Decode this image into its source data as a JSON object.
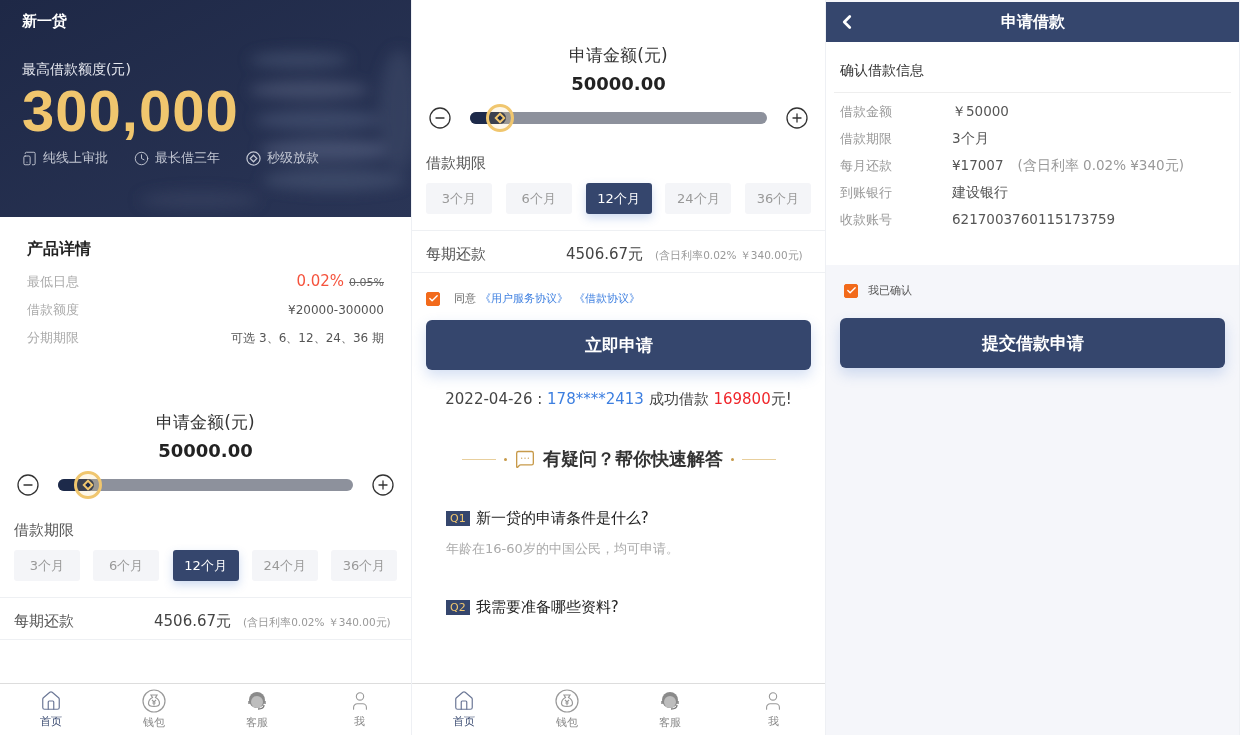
{
  "home_screen": {
    "brand": "新一贷",
    "hero": {
      "label": "最高借款额度(元)",
      "amount": "300,000",
      "features": [
        {
          "kind": "tablet",
          "text": "纯线上审批"
        },
        {
          "kind": "clock",
          "text": "最长借三年"
        },
        {
          "kind": "coin",
          "text": "秒级放款"
        }
      ]
    },
    "details": {
      "title": "产品详情",
      "rows": [
        {
          "label": "最低日息",
          "value": "0.02%",
          "old_value": "0.05%"
        },
        {
          "label": "借款额度",
          "value": "¥20000-300000"
        },
        {
          "label": "分期期限",
          "value": "可选 3、6、12、24、36 期"
        }
      ]
    },
    "amount": {
      "label": "申请金额(元)",
      "value": "50000.00",
      "level": 0.1
    },
    "term": {
      "label": "借款期限",
      "options": [
        {
          "label": "3个月",
          "selected": false
        },
        {
          "label": "6个月",
          "selected": false
        },
        {
          "label": "12个月",
          "selected": true
        },
        {
          "label": "24个月",
          "selected": false
        },
        {
          "label": "36个月",
          "selected": false
        }
      ]
    },
    "repayment": {
      "label": "每期还款",
      "amount": "4506.67元",
      "note": "(含日利率0.02% ￥340.00元)"
    },
    "tab_bar": [
      {
        "kind": "home",
        "label": "首页",
        "selected": true
      },
      {
        "kind": "wallet",
        "label": "钱包",
        "selected": false
      },
      {
        "kind": "service",
        "label": "客服",
        "selected": false
      },
      {
        "kind": "profile",
        "label": "我",
        "selected": false
      }
    ]
  },
  "apply_screen": {
    "amount": {
      "label": "申请金额(元)",
      "value": "50000.00",
      "level": 0.1
    },
    "term": {
      "label": "借款期限",
      "options": [
        {
          "label": "3个月",
          "selected": false
        },
        {
          "label": "6个月",
          "selected": false
        },
        {
          "label": "12个月",
          "selected": true
        },
        {
          "label": "24个月",
          "selected": false
        },
        {
          "label": "36个月",
          "selected": false
        }
      ]
    },
    "repayment": {
      "label": "每期还款",
      "amount": "4506.67元",
      "note": "(含日利率0.02% ￥340.00元)"
    },
    "agreement": {
      "checked": true,
      "text": "同意",
      "links": [
        "《用户服务协议》",
        "《借款协议》"
      ]
    },
    "apply_button": "立即申请",
    "ticker": {
      "date": "2022-04-26 :",
      "phone": "178****2413",
      "text": "成功借款",
      "amount": "169800",
      "suffix": "元!"
    },
    "faq": {
      "title": "有疑问？帮你快速解答",
      "items": [
        {
          "tag": "Q1",
          "question": "新一贷的申请条件是什么?",
          "answer": "年龄在16-60岁的中国公民，均可申请。"
        },
        {
          "tag": "Q2",
          "question": "我需要准备哪些资料?"
        }
      ]
    },
    "tab_bar": [
      {
        "kind": "home",
        "label": "首页",
        "selected": true
      },
      {
        "kind": "wallet",
        "label": "钱包",
        "selected": false
      },
      {
        "kind": "service",
        "label": "客服",
        "selected": false
      },
      {
        "kind": "profile",
        "label": "我",
        "selected": false
      }
    ]
  },
  "confirm_screen": {
    "title": "申请借款",
    "section_title": "确认借款信息",
    "rows": [
      {
        "label": "借款金额",
        "value": "￥50000"
      },
      {
        "label": "借款期限",
        "value": "3个月"
      },
      {
        "label": "每月还款",
        "value": "¥17007",
        "note": "(含日利率 0.02% ¥340元)"
      },
      {
        "label": "到账银行",
        "value": "建设银行"
      },
      {
        "label": "收款账号",
        "value": "6217003760115173759"
      }
    ],
    "confirmation": {
      "checked": true,
      "text": "我已确认"
    },
    "submit_button": "提交借款申请"
  }
}
